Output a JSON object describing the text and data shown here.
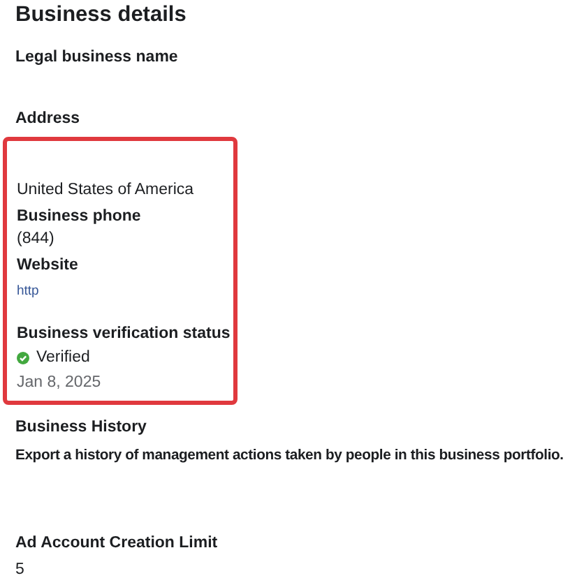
{
  "title": "Business details",
  "fields": [
    {
      "label": "Legal business name"
    },
    {
      "label": "Address"
    }
  ],
  "highlighted": {
    "address_lines": [
      "United States of America"
    ],
    "phone": {
      "label": "Business phone",
      "value": "(844)"
    },
    "website": {
      "label": "Website",
      "value": "http"
    },
    "verification": {
      "label": "Business verification status",
      "status": "Verified",
      "date": "Jan 8, 2025"
    }
  },
  "history": {
    "label": "Business History",
    "description": "Export a history of management actions taken by people in this business portfolio."
  },
  "limit": {
    "label": "Ad Account Creation Limit",
    "value": "5"
  }
}
